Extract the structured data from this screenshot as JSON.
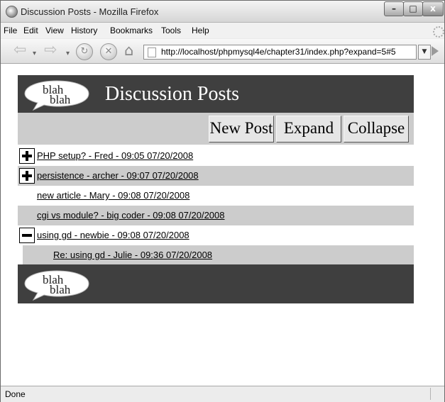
{
  "window": {
    "title": "Discussion Posts - Mozilla Firefox",
    "controls": {
      "minimize": "–",
      "maximize": "□",
      "close": "x"
    }
  },
  "menu": [
    "File",
    "Edit",
    "View",
    "History",
    "Bookmarks",
    "Tools",
    "Help"
  ],
  "navigation": {
    "url": "http://localhost/phpmysql4e/chapter31/index.php?expand=5#5"
  },
  "page": {
    "logo_line1": "blah",
    "logo_line2": "blah",
    "title": "Discussion Posts",
    "buttons": {
      "new_post": "New Post",
      "expand": "Expand",
      "collapse": "Collapse"
    },
    "posts": [
      {
        "text": "PHP setup? - Fred - 09:05 07/20/2008",
        "toggle": "plus",
        "shaded": false,
        "indent": 0
      },
      {
        "text": "persistence - archer - 09:07 07/20/2008",
        "toggle": "plus",
        "shaded": true,
        "indent": 0
      },
      {
        "text": "new article - Mary - 09:08 07/20/2008",
        "toggle": "none",
        "shaded": false,
        "indent": 0
      },
      {
        "text": "cgi vs module? - big coder - 09:08 07/20/2008",
        "toggle": "none",
        "shaded": true,
        "indent": 0
      },
      {
        "text": "using gd - newbie - 09:08 07/20/2008",
        "toggle": "minus",
        "shaded": false,
        "indent": 0
      },
      {
        "text": "Re: using gd - Julie - 09:36 07/20/2008",
        "toggle": "none",
        "shaded": true,
        "indent": 1
      }
    ],
    "footer_logo_line1": "blah",
    "footer_logo_line2": "blah"
  },
  "status": {
    "text": "Done"
  },
  "colors": {
    "banner": "#3f3f3f",
    "row_shade": "#cccccc",
    "page_bg": "#ffffff"
  }
}
